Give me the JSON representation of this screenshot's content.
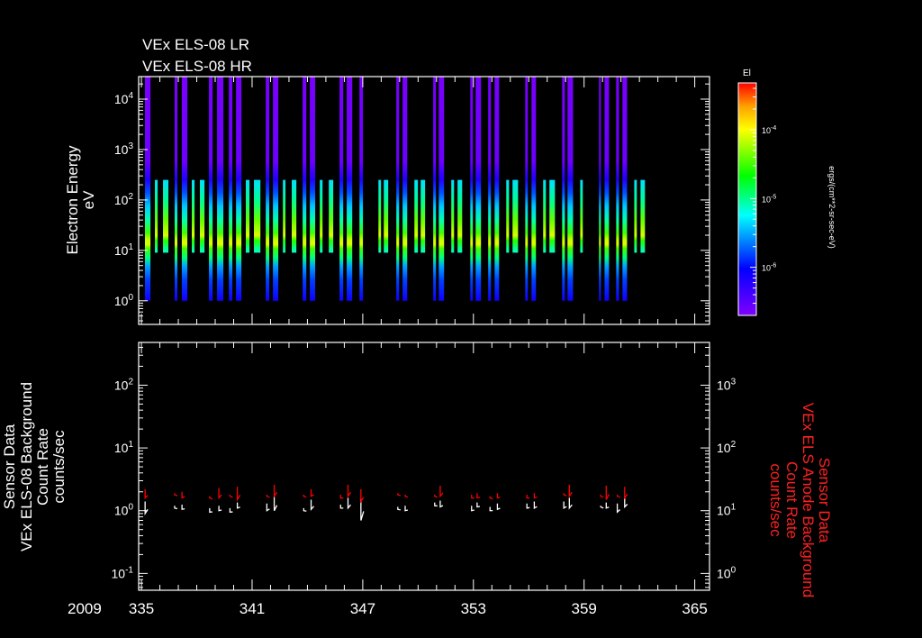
{
  "titles": [
    "VEx ELS-08 LR",
    "VEx ELS-08 HR"
  ],
  "year_label": "2009",
  "colors": {
    "background": "#000000",
    "axes": "#ffffff",
    "right_axis_label": "#ff2020",
    "bg_rate_series": "#ffffff",
    "anode_series": "#ff0000"
  },
  "chart_data": {
    "type": "heatmap",
    "x_ticks": [
      "335",
      "341",
      "347",
      "353",
      "359",
      "365"
    ],
    "xlim": [
      334.85,
      365.8
    ],
    "xlabel": "",
    "spectrogram": {
      "ylabel": [
        "Electron Energy",
        "eV"
      ],
      "yscale": "log",
      "ylim": [
        0.34,
        28000
      ],
      "y_ticks": [
        {
          "base": "10",
          "exp": "0"
        },
        {
          "base": "10",
          "exp": "1"
        },
        {
          "base": "10",
          "exp": "2"
        },
        {
          "base": "10",
          "exp": "3"
        },
        {
          "base": "10",
          "exp": "4"
        }
      ],
      "y_tick_values": [
        1,
        10,
        100,
        1000,
        10000
      ],
      "full_range_strips": {
        "energy_range_eV": [
          1,
          28000
        ],
        "days": [
          [
            335.19,
            335.49
          ],
          [
            336.8,
            336.95
          ],
          [
            337.19,
            337.49
          ],
          [
            338.66,
            338.86
          ],
          [
            339.1,
            339.44
          ],
          [
            339.74,
            339.93
          ],
          [
            340.13,
            340.42
          ],
          [
            341.74,
            341.93
          ],
          [
            342.13,
            342.42
          ],
          [
            343.74,
            343.94
          ],
          [
            344.13,
            344.42
          ],
          [
            345.74,
            345.94
          ],
          [
            346.13,
            346.43
          ],
          [
            346.82,
            347.01
          ],
          [
            348.82,
            348.97
          ],
          [
            349.16,
            349.41
          ],
          [
            350.82,
            350.97
          ],
          [
            351.12,
            351.41
          ],
          [
            352.83,
            352.97
          ],
          [
            353.12,
            353.41
          ],
          [
            353.8,
            353.95
          ],
          [
            354.15,
            354.39
          ],
          [
            355.81,
            355.95
          ],
          [
            356.15,
            356.39
          ],
          [
            357.81,
            357.96
          ],
          [
            358.1,
            358.4
          ],
          [
            359.81,
            359.91
          ],
          [
            360.11,
            360.35
          ],
          [
            360.74,
            360.89
          ],
          [
            361.08,
            361.33
          ]
        ]
      },
      "low_range_strips": {
        "energy_range_eV": [
          9,
          250
        ],
        "days": [
          [
            335.73,
            335.88
          ],
          [
            336.17,
            336.46
          ],
          [
            337.73,
            337.88
          ],
          [
            338.17,
            338.42
          ],
          [
            340.66,
            340.86
          ],
          [
            341.1,
            341.45
          ],
          [
            342.67,
            342.81
          ],
          [
            343.15,
            343.4
          ],
          [
            344.67,
            344.82
          ],
          [
            345.16,
            345.4
          ],
          [
            347.85,
            347.99
          ],
          [
            348.14,
            348.38
          ],
          [
            349.8,
            349.99
          ],
          [
            350.14,
            350.38
          ],
          [
            351.8,
            351.95
          ],
          [
            352.14,
            352.39
          ],
          [
            354.78,
            354.93
          ],
          [
            355.12,
            355.42
          ],
          [
            356.78,
            356.93
          ],
          [
            357.12,
            357.42
          ],
          [
            358.79,
            358.93
          ],
          [
            361.72,
            361.86
          ],
          [
            362.06,
            362.3
          ]
        ]
      },
      "peak_energy_eV": 20,
      "colorbar": {
        "title": "El",
        "label": "ergs/(cm**2-sr-sec-eV)",
        "scale": "log",
        "range": [
          2e-07,
          0.00048
        ],
        "ticks": [
          {
            "base": "10",
            "exp": "-4"
          },
          {
            "base": "10",
            "exp": "-5"
          },
          {
            "base": "10",
            "exp": "-6"
          }
        ],
        "tick_values": [
          0.0001,
          1e-05,
          1e-06
        ]
      }
    },
    "rates": {
      "type": "line",
      "left_label": [
        "Sensor Data",
        "VEx ELS-08 Background",
        "Count Rate",
        "counts/sec"
      ],
      "right_label": [
        "Sensor Data",
        "VEx ELS Anode Background",
        "Count Rate",
        "counts/sec"
      ],
      "left_ylim": [
        0.054,
        480
      ],
      "right_ylim": [
        0.54,
        4800
      ],
      "left_ticks": [
        {
          "base": "10",
          "exp": "-1"
        },
        {
          "base": "10",
          "exp": "0"
        },
        {
          "base": "10",
          "exp": "1"
        },
        {
          "base": "10",
          "exp": "2"
        }
      ],
      "left_tick_values": [
        0.1,
        1,
        10,
        100
      ],
      "right_ticks": [
        {
          "base": "10",
          "exp": "0"
        },
        {
          "base": "10",
          "exp": "1"
        },
        {
          "base": "10",
          "exp": "2"
        },
        {
          "base": "10",
          "exp": "3"
        }
      ],
      "right_tick_values": [
        1,
        10,
        100,
        1000
      ],
      "series": [
        {
          "name": "VEx ELS-08 Background Count Rate",
          "axis": "left",
          "color": "#ffffff",
          "segments": [
            [
              335.2,
              0.9,
              1.4
            ],
            [
              336.8,
              1.1,
              1.2
            ],
            [
              337.2,
              1.05,
              1.25
            ],
            [
              338.7,
              0.95,
              1.1
            ],
            [
              339.2,
              1.0,
              1.2
            ],
            [
              339.8,
              0.95,
              1.1
            ],
            [
              340.2,
              1.1,
              1.35
            ],
            [
              341.8,
              1.0,
              1.3
            ],
            [
              342.2,
              1.0,
              1.7
            ],
            [
              343.8,
              1.0,
              1.1
            ],
            [
              344.2,
              1.05,
              1.5
            ],
            [
              345.8,
              1.1,
              1.25
            ],
            [
              346.2,
              1.1,
              1.6
            ],
            [
              346.9,
              0.7,
              1.55
            ],
            [
              348.9,
              1.05,
              1.15
            ],
            [
              349.3,
              1.0,
              1.2
            ],
            [
              350.9,
              1.2,
              1.35
            ],
            [
              351.2,
              1.15,
              1.45
            ],
            [
              352.9,
              1.0,
              1.2
            ],
            [
              353.2,
              1.15,
              1.35
            ],
            [
              353.9,
              1.0,
              1.15
            ],
            [
              354.3,
              1.05,
              1.3
            ],
            [
              355.9,
              1.1,
              1.3
            ],
            [
              356.3,
              1.1,
              1.4
            ],
            [
              357.9,
              1.1,
              1.4
            ],
            [
              358.2,
              1.1,
              1.6
            ],
            [
              359.9,
              1.15,
              1.2
            ],
            [
              360.2,
              1.1,
              1.35
            ],
            [
              360.8,
              0.95,
              1.3
            ],
            [
              361.2,
              1.15,
              1.6
            ]
          ]
        },
        {
          "name": "VEx ELS Anode Background Count Rate",
          "axis": "right",
          "color": "#ff0000",
          "segments": [
            [
              335.2,
              16,
              22
            ],
            [
              336.8,
              18,
              19
            ],
            [
              337.2,
              16,
              20
            ],
            [
              338.7,
              16,
              17
            ],
            [
              339.2,
              16,
              23
            ],
            [
              339.8,
              17,
              18
            ],
            [
              340.2,
              15,
              24
            ],
            [
              341.8,
              17,
              18
            ],
            [
              342.2,
              17,
              26
            ],
            [
              343.8,
              17,
              18
            ],
            [
              344.2,
              17,
              22
            ],
            [
              345.8,
              16,
              18
            ],
            [
              346.2,
              17,
              26
            ],
            [
              346.9,
              14,
              22
            ],
            [
              348.9,
              18,
              19
            ],
            [
              349.3,
              17,
              18
            ],
            [
              350.9,
              17,
              18
            ],
            [
              351.2,
              17,
              25
            ],
            [
              352.9,
              16,
              18
            ],
            [
              353.2,
              16,
              19
            ],
            [
              353.9,
              16,
              17
            ],
            [
              354.3,
              16,
              19
            ],
            [
              355.9,
              16,
              18
            ],
            [
              356.3,
              16,
              19
            ],
            [
              357.9,
              18,
              19
            ],
            [
              358.2,
              17,
              26
            ],
            [
              359.9,
              17,
              18
            ],
            [
              360.2,
              15,
              25
            ],
            [
              360.8,
              17,
              18
            ],
            [
              361.2,
              16,
              24
            ]
          ]
        }
      ]
    }
  }
}
